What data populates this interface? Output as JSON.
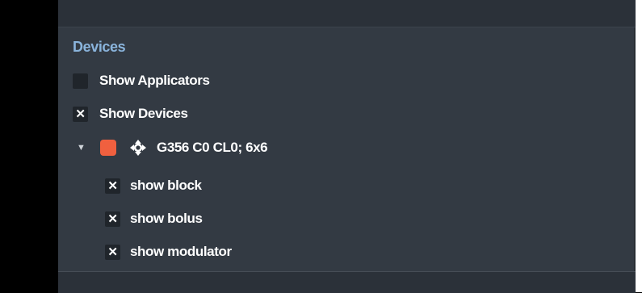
{
  "panel": {
    "section_title": "Devices",
    "show_applicators": {
      "label": "Show Applicators",
      "checked": false
    },
    "show_devices": {
      "label": "Show Devices",
      "checked": true
    },
    "device": {
      "name": "G356 C0 CL0; 6x6",
      "color": "#f0603f",
      "expanded": true,
      "icon": "move-icon",
      "options": [
        {
          "label": "show block",
          "checked": true
        },
        {
          "label": "show bolus",
          "checked": true
        },
        {
          "label": "show modulator",
          "checked": true
        }
      ]
    }
  }
}
